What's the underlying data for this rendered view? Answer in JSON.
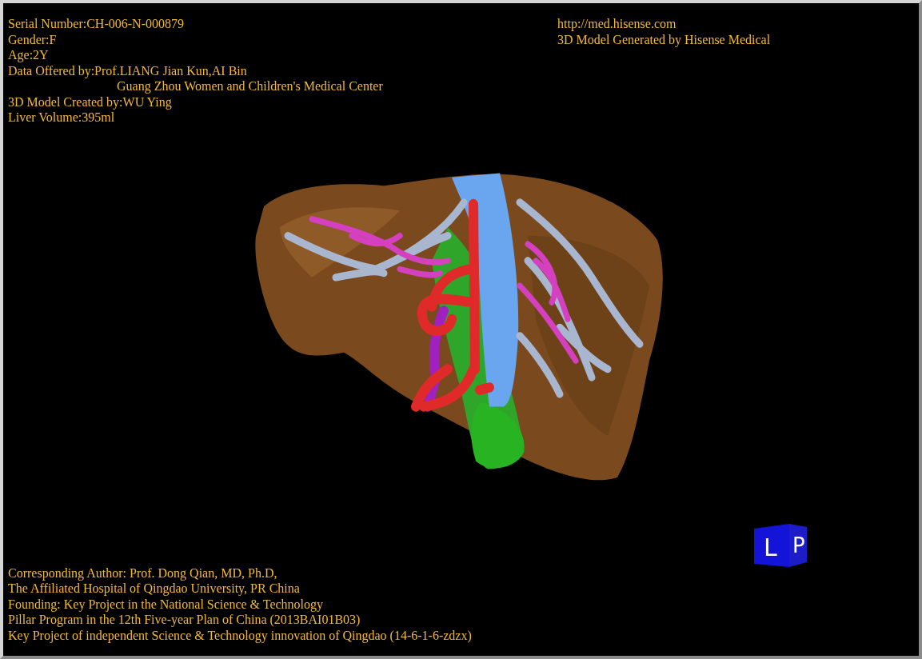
{
  "patient_info": [
    {
      "text": "Serial Number:CH-006-N-000879",
      "indent": false
    },
    {
      "text": "Gender:F",
      "indent": false
    },
    {
      "text": "Age:2Y",
      "indent": false
    },
    {
      "text": "Data Offered by:Prof.LIANG Jian Kun,AI Bin",
      "indent": false
    },
    {
      "text": "Guang Zhou Women and Children's Medical Center",
      "indent": true
    },
    {
      "text": "3D Model Created by:WU Ying",
      "indent": false
    },
    {
      "text": "Liver Volume:395ml",
      "indent": false
    }
  ],
  "vendor_info": [
    "http://med.hisense.com",
    "3D Model Generated by Hisense Medical"
  ],
  "credits": [
    "Corresponding Author: Prof. Dong Qian, MD, Ph.D,",
    "The Affiliated Hospital of Qingdao University, PR China",
    "Founding: Key Project in the National Science & Technology",
    "Pillar Program in the 12th Five-year Plan of China (2013BAI01B03)",
    "Key Project of independent Science & Technology innovation of Qingdao (14-6-1-6-zdzx)"
  ],
  "orientation_cube": {
    "left_face": "L",
    "right_face": "P"
  }
}
